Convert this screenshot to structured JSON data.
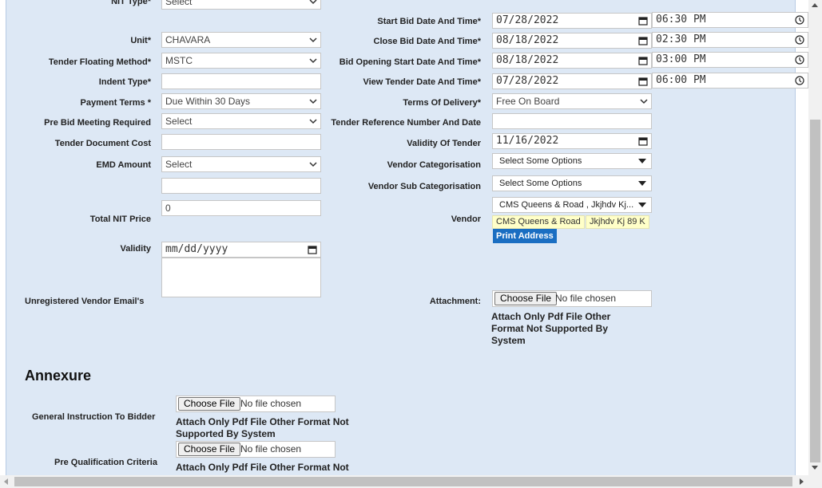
{
  "form": {
    "nit_type_label": "NIT Type*",
    "nit_type_value": "Select",
    "unit_label": "Unit*",
    "unit_value": "CHAVARA",
    "tender_floating_label": "Tender Floating Method*",
    "tender_floating_value": "MSTC",
    "indent_type_label": "Indent Type*",
    "indent_type_value": "",
    "payment_terms_label": "Payment Terms *",
    "payment_terms_value": "Due Within 30 Days",
    "pre_bid_label": "Pre Bid Meeting Required",
    "pre_bid_value": "Select",
    "tender_doc_cost_label": "Tender Document Cost",
    "tender_doc_cost_value": "",
    "emd_label": "EMD Amount",
    "emd_value": "Select",
    "emd_extra_value": "",
    "total_nit_label": "Total NIT Price",
    "total_nit_value": "0",
    "validity_label": "Validity",
    "validity_value": "mm/dd/yyyy",
    "unreg_email_label": "Unregistered Vendor Email's",
    "start_bid_label": "Start Bid Date And Time*",
    "start_bid_date": "07/28/2022",
    "start_bid_time": "06:30 PM",
    "close_bid_label": "Close Bid Date And Time*",
    "close_bid_date": "08/18/2022",
    "close_bid_time": "02:30 PM",
    "bid_open_label": "Bid Opening Start Date And Time*",
    "bid_open_date": "08/18/2022",
    "bid_open_time": "03:00 PM",
    "view_tender_label": "View Tender Date And Time*",
    "view_tender_date": "07/28/2022",
    "view_tender_time": "06:00 PM",
    "terms_delivery_label": "Terms Of Delivery*",
    "terms_delivery_value": "Free On Board",
    "tender_ref_label": "Tender Reference Number And Date",
    "tender_ref_value": "",
    "validity_tender_label": "Validity Of Tender",
    "validity_tender_value": "11/16/2022",
    "vendor_cat_label": "Vendor Categorisation",
    "vendor_cat_value": "Select Some Options",
    "vendor_subcat_label": "Vendor Sub Categorisation",
    "vendor_subcat_value": "Select Some Options",
    "vendor_label": "Vendor",
    "vendor_value": "CMS Queens & Road , Jkjhdv Kj...",
    "vendor_chips": [
      "CMS Queens & Road",
      "Jkjhdv Kj 89 K"
    ],
    "print_address": "Print Address",
    "attachment_label": "Attachment:",
    "choose_file": "Choose File",
    "no_file": "No file chosen",
    "attach_note": "Attach Only Pdf File Other Format Not Supported By System"
  },
  "annexure": {
    "heading": "Annexure",
    "general_label": "General Instruction To Bidder",
    "general_note": "Attach Only Pdf File Other Format Not Supported By System",
    "prequal_label": "Pre Qualification Criteria",
    "prequal_note": "Attach Only Pdf File Other Format Not"
  }
}
